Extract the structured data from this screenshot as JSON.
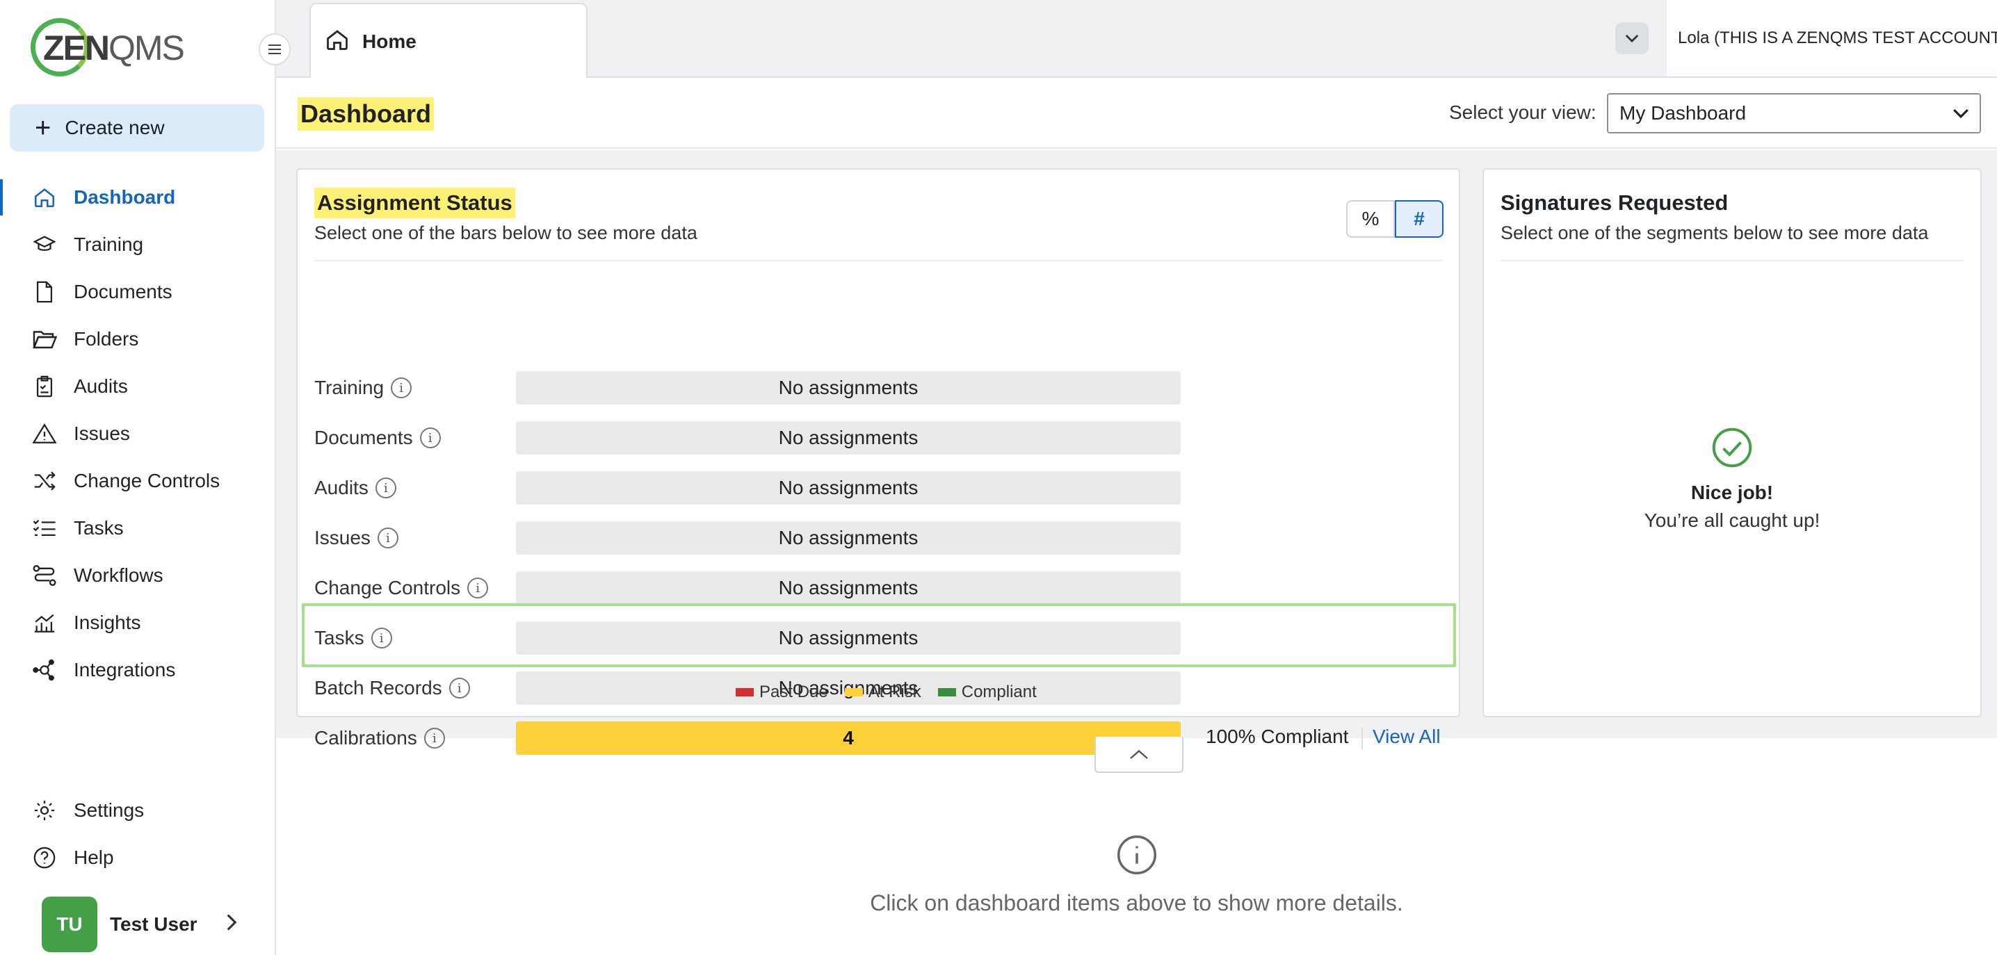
{
  "app": {
    "logo_bold": "ZEN",
    "logo_thin": "QMS"
  },
  "sidebar": {
    "create_label": "Create new",
    "items": [
      {
        "label": "Dashboard",
        "icon": "home-icon"
      },
      {
        "label": "Training",
        "icon": "graduation-cap-icon"
      },
      {
        "label": "Documents",
        "icon": "document-icon"
      },
      {
        "label": "Folders",
        "icon": "folder-icon"
      },
      {
        "label": "Audits",
        "icon": "clipboard-icon"
      },
      {
        "label": "Issues",
        "icon": "warning-icon"
      },
      {
        "label": "Change Controls",
        "icon": "shuffle-icon"
      },
      {
        "label": "Tasks",
        "icon": "checklist-icon"
      },
      {
        "label": "Workflows",
        "icon": "workflow-icon"
      },
      {
        "label": "Insights",
        "icon": "insights-icon"
      },
      {
        "label": "Integrations",
        "icon": "integrations-icon"
      }
    ],
    "bottom": [
      {
        "label": "Settings",
        "icon": "gear-icon"
      },
      {
        "label": "Help",
        "icon": "help-icon"
      }
    ],
    "user": {
      "initials": "TU",
      "name": "Test User"
    }
  },
  "topbar": {
    "tab_label": "Home",
    "account": "Lola (THIS IS A ZENQMS TEST ACCOUNT)"
  },
  "dashboard": {
    "title": "Dashboard",
    "view_label": "Select your view:",
    "view_value": "My Dashboard"
  },
  "assignment": {
    "title": "Assignment Status",
    "subtitle": "Select one of the bars below to see more data",
    "toggle_pct": "%",
    "toggle_num": "#",
    "rows": [
      {
        "label": "Training",
        "value": "No assignments"
      },
      {
        "label": "Documents",
        "value": "No assignments"
      },
      {
        "label": "Audits",
        "value": "No assignments"
      },
      {
        "label": "Issues",
        "value": "No assignments"
      },
      {
        "label": "Change Controls",
        "value": "No assignments"
      },
      {
        "label": "Tasks",
        "value": "No assignments"
      },
      {
        "label": "Batch Records",
        "value": "No assignments"
      },
      {
        "label": "Calibrations",
        "value": "4",
        "compliance": "100% Compliant",
        "link": "View All"
      }
    ],
    "legend": [
      {
        "label": "Past Due",
        "color": "#d32f2f"
      },
      {
        "label": "At Risk",
        "color": "#fdd13a"
      },
      {
        "label": "Compliant",
        "color": "#388e3c"
      }
    ]
  },
  "signatures": {
    "title": "Signatures Requested",
    "subtitle": "Select one of the segments below to see more data",
    "empty_title": "Nice job!",
    "empty_sub": "You’re all caught up!"
  },
  "details_hint": "Click on dashboard items above to show more details."
}
